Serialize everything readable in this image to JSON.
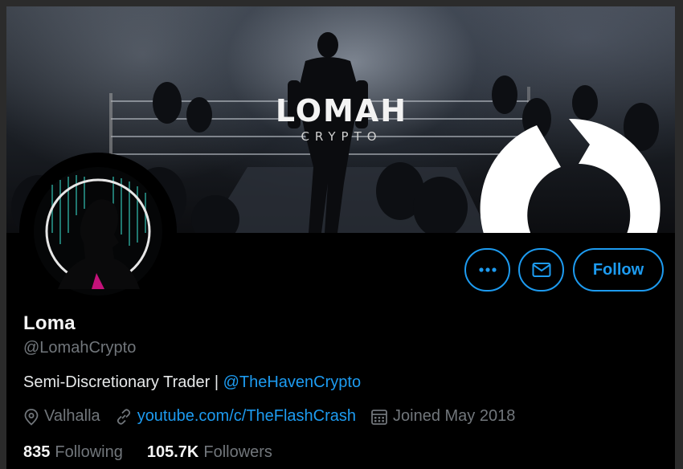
{
  "banner": {
    "logo_main": "LOMAH",
    "logo_sub": "CRYPTO"
  },
  "actions": {
    "more_label": "More",
    "message_label": "Message",
    "follow_label": "Follow"
  },
  "profile": {
    "name": "Loma",
    "handle": "@LomahCrypto",
    "bio_text": "Semi-Discretionary Trader | ",
    "bio_link": "@TheHavenCrypto",
    "location": "Valhalla",
    "website": "youtube.com/c/TheFlashCrash",
    "joined": "Joined May 2018",
    "following_count": "835",
    "following_label": "Following",
    "followers_count": "105.7K",
    "followers_label": "Followers"
  },
  "colors": {
    "accent": "#1d9bf0",
    "secondary_text": "#71767b",
    "background": "#000000"
  },
  "icons": [
    "more-icon",
    "mail-icon",
    "location-icon",
    "link-icon",
    "calendar-icon"
  ]
}
